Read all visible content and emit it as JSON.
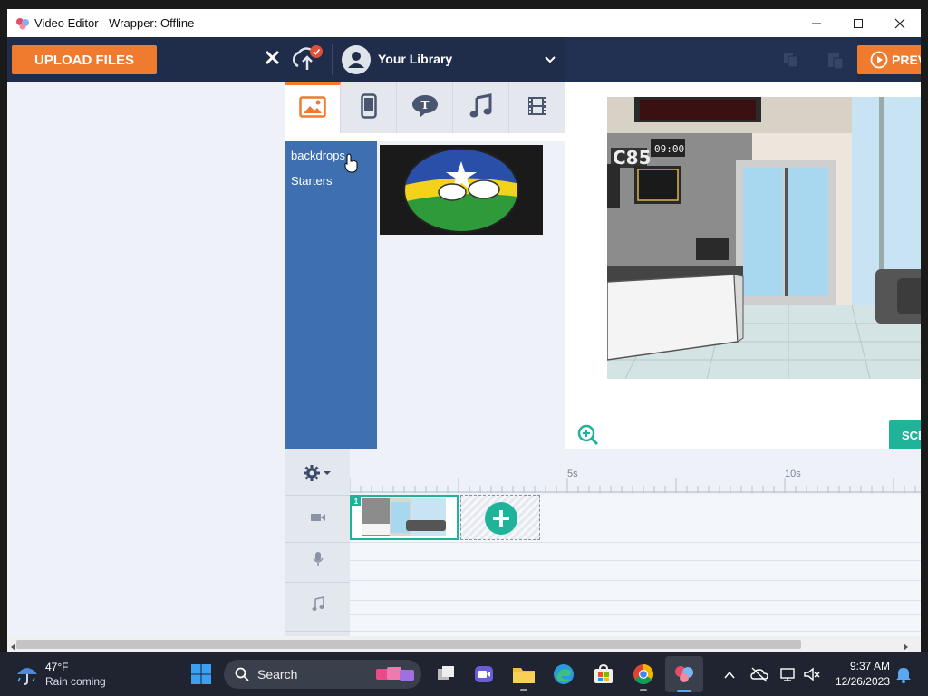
{
  "window": {
    "title": "Video Editor - Wrapper: Offline"
  },
  "topbar": {
    "upload_label": "UPLOAD FILES",
    "library_label": "Your Library",
    "preview_label": "PREV"
  },
  "asset_tabs": [
    {
      "name": "image"
    },
    {
      "name": "phone"
    },
    {
      "name": "text"
    },
    {
      "name": "music"
    },
    {
      "name": "video"
    }
  ],
  "categories": [
    {
      "label": "backdrops"
    },
    {
      "label": "Starters"
    }
  ],
  "stage": {
    "sign_code": "C85",
    "sign_time": "09:00",
    "scene_button_label": "SCE"
  },
  "timeline": {
    "ruler_marks": [
      "5s",
      "10s"
    ],
    "scene_number": "1"
  },
  "taskbar": {
    "weather_temp": "47°F",
    "weather_desc": "Rain coming",
    "search_label": "Search",
    "time": "9:37 AM",
    "date": "12/26/2023"
  },
  "colors": {
    "accent_orange": "#f07a2e",
    "topbar_navy": "#1f2c4a",
    "category_blue": "#3e6fb0",
    "teal": "#1fb39a"
  }
}
